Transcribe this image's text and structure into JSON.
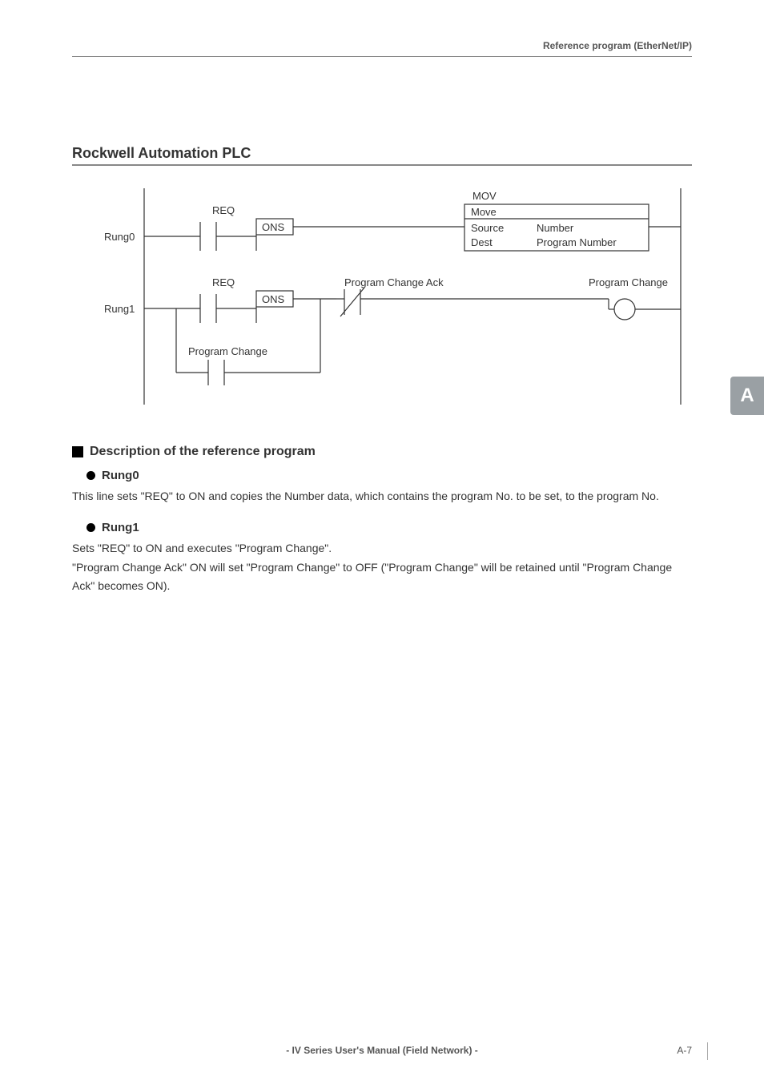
{
  "header": {
    "breadcrumb": "Reference program (EtherNet/IP)"
  },
  "section": {
    "title": "Rockwell Automation PLC"
  },
  "ladder": {
    "rung0_label": "Rung0",
    "rung1_label": "Rung1",
    "req_label": "REQ",
    "ons_label": "ONS",
    "mov_label": "MOV",
    "move_label": "Move",
    "source_label": "Source",
    "dest_label": "Dest",
    "number_label": "Number",
    "program_number_label": "Program Number",
    "program_change_ack_label": "Program Change Ack",
    "program_change_label": "Program Change",
    "program_change_contact_label": "Program Change"
  },
  "description": {
    "heading": "Description of the reference program",
    "rung0": {
      "title": "Rung0",
      "text": "This line sets \"REQ\" to ON and copies the Number data, which contains the program No. to be set, to the program No."
    },
    "rung1": {
      "title": "Rung1",
      "text": "Sets \"REQ\" to ON and executes \"Program Change\".\n\"Program Change Ack\" ON will set \"Program Change\" to OFF (\"Program Change\" will be retained until \"Program Change Ack\" becomes ON)."
    }
  },
  "sidebar": {
    "tab": "A"
  },
  "footer": {
    "center": "- IV Series User's Manual (Field Network) -",
    "page": "A-7"
  }
}
